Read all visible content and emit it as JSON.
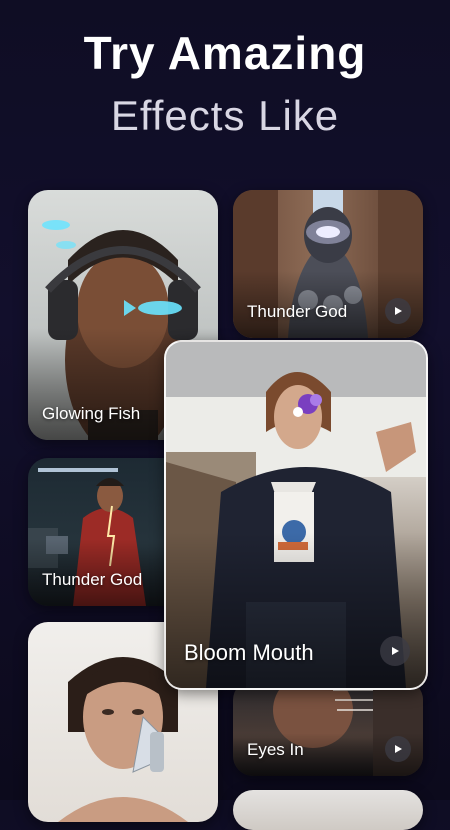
{
  "header": {
    "title": "Try Amazing",
    "subtitle": "Effects Like"
  },
  "cards": [
    {
      "label": "Glowing Fish",
      "has_play": false
    },
    {
      "label": "Thunder God",
      "has_play": true
    },
    {
      "label": "Thunder God",
      "has_play": false
    },
    {
      "label": "Bloom Mouth",
      "has_play": true
    },
    {
      "label": "Eyes In",
      "has_play": true
    },
    {
      "label": "",
      "has_play": false
    },
    {
      "label": "",
      "has_play": false
    }
  ],
  "icons": {
    "play": "play-icon"
  },
  "colors": {
    "background": "#0f0d24",
    "text": "#ffffff",
    "play_bg": "#3c3c46"
  }
}
